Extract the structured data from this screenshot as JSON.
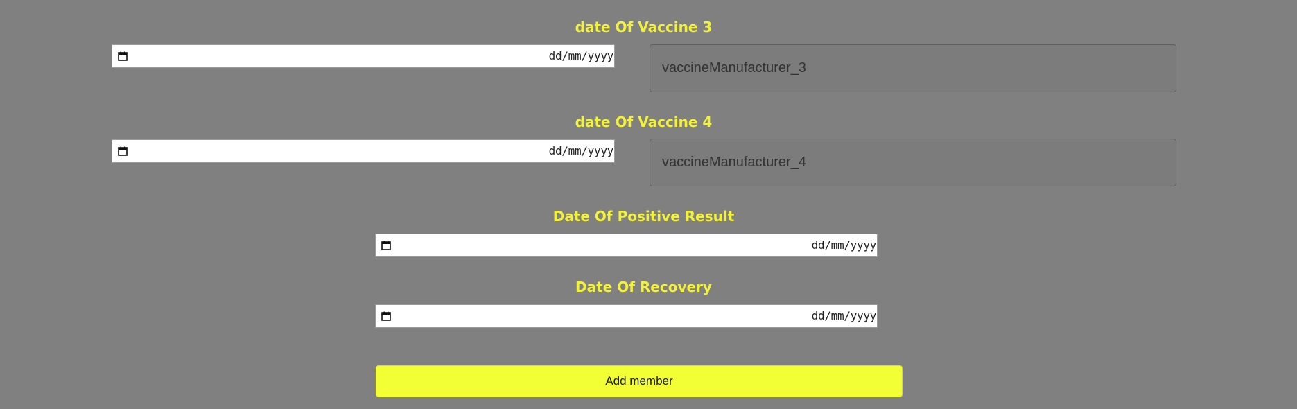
{
  "form": {
    "vaccine3": {
      "date_label": "date Of Vaccine 3",
      "date_format": "dd/mm/yyyy",
      "manufacturer_placeholder": "vaccineManufacturer_3"
    },
    "vaccine4": {
      "date_label": "date Of Vaccine 4",
      "date_format": "dd/mm/yyyy",
      "manufacturer_placeholder": "vaccineManufacturer_4"
    },
    "positive_result": {
      "label": "Date Of Positive Result",
      "date_format": "dd/mm/yyyy"
    },
    "recovery": {
      "label": "Date Of Recovery",
      "date_format": "dd/mm/yyyy"
    },
    "submit_label": "Add member"
  },
  "colors": {
    "background": "#808080",
    "label": "#f2f23a",
    "button": "#f2ff34"
  },
  "icons": {
    "date_picker": "calendar-icon"
  }
}
